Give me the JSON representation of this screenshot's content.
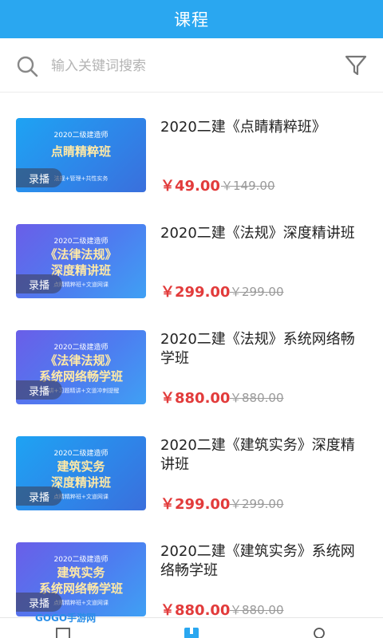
{
  "header": {
    "title": "课程"
  },
  "search": {
    "placeholder": "输入关键词搜索"
  },
  "courses": [
    {
      "title": "2020二建《点睛精粹班》",
      "price": "￥49.00",
      "original_price": "￥149.00",
      "thumb": {
        "top": "2020二级建造师",
        "main": "点睛精粹班",
        "sub": "法规+管理+共性实务",
        "badge": "录播"
      }
    },
    {
      "title": "2020二建《法规》深度精讲班",
      "price": "￥299.00",
      "original_price": "￥299.00",
      "thumb": {
        "top": "2020二级建造师",
        "main": "《法律法规》\n深度精讲班",
        "sub": "点睛精粹班+文道网课",
        "badge": "录播"
      }
    },
    {
      "title": "2020二建《法规》系统网络畅学班",
      "price": "￥880.00",
      "original_price": "￥880.00",
      "thumb": {
        "top": "2020二级建造师",
        "main": "《法律法规》\n系统网络畅学班",
        "sub": "精讲+习题精讲+文道冲刺提醒",
        "badge": "录播"
      }
    },
    {
      "title": "2020二建《建筑实务》深度精讲班",
      "price": "￥299.00",
      "original_price": "￥299.00",
      "thumb": {
        "top": "2020二级建造师",
        "main": "建筑实务\n深度精讲班",
        "sub": "点睛精粹班+文道网课",
        "badge": "录播"
      }
    },
    {
      "title": "2020二建《建筑实务》系统网络畅学班",
      "price": "￥880.00",
      "original_price": "￥880.00",
      "thumb": {
        "top": "2020二级建造师",
        "main": "建筑实务\n系统网络畅学班",
        "sub": "点睛精粹班+文道网课",
        "badge": "录播"
      }
    }
  ],
  "tabbar": {
    "icons": [
      "list-icon",
      "book-icon",
      "user-icon"
    ],
    "active_color": "#2aa7f0"
  },
  "watermark": "GOGO手游网",
  "colors": {
    "primary": "#2aa7f0",
    "price": "#e23b3b",
    "muted": "#9a9a9a"
  }
}
